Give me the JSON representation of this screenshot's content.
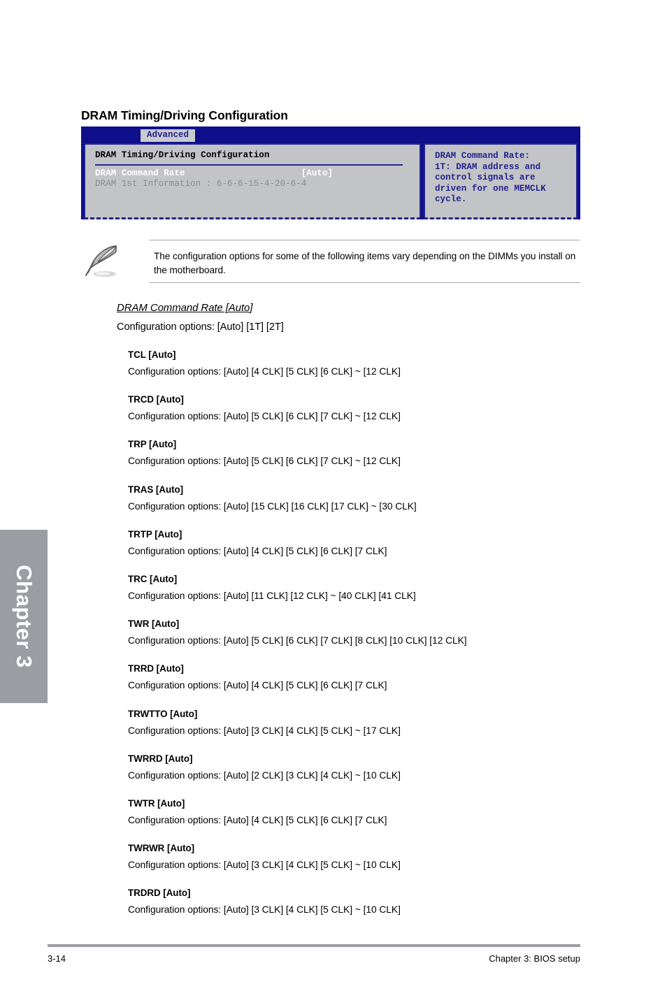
{
  "chapter_tab": {
    "label": "Chapter 3"
  },
  "page_title": "DRAM Timing/Driving Configuration",
  "bios": {
    "tab_label": "Advanced",
    "section_title": "DRAM Timing/Driving Configuration",
    "rows": [
      {
        "label": "DRAM Command Rate",
        "value": "[Auto]"
      },
      {
        "label": "DRAM 1st Information : 6-6-6-15-4-20-6-4",
        "value": ""
      }
    ],
    "row_active_text": "DRAM Command Rate                      [Auto]",
    "row_dim_text": "DRAM 1st Information : 6-6-6-15-4-20-6-4",
    "help_text": "DRAM Command Rate:\n1T: DRAM address and\ncontrol signals are\ndriven for one MEMCLK\ncycle.",
    "colors": {
      "header_blue": "#0f0f8c",
      "panel_gray": "#c3c4c8",
      "border_blue": "#23238c",
      "active_white": "#ffffff",
      "dim_gray": "#8a8b90"
    }
  },
  "note": {
    "icon": "quill-pen-icon",
    "text": "The configuration options for some of the following items vary depending on the DIMMs you install on the motherboard."
  },
  "lead_item": {
    "heading": "DRAM Command Rate [Auto]",
    "options": "Configuration options: [Auto] [1T] [2T]"
  },
  "items": [
    {
      "title": "TCL [Auto]",
      "options": "Configuration options: [Auto] [4 CLK] [5 CLK] [6 CLK] ~ [12 CLK]"
    },
    {
      "title": "TRCD [Auto]",
      "options": "Configuration options: [Auto] [5 CLK] [6 CLK] [7 CLK] ~ [12 CLK]"
    },
    {
      "title": "TRP [Auto]",
      "options": "Configuration options: [Auto] [5 CLK] [6 CLK] [7 CLK] ~ [12 CLK]"
    },
    {
      "title": "TRAS [Auto]",
      "options": "Configuration options: [Auto] [15 CLK] [16 CLK] [17 CLK] ~ [30 CLK]"
    },
    {
      "title": "TRTP [Auto]",
      "options": "Configuration options: [Auto] [4 CLK] [5 CLK] [6 CLK] [7 CLK]"
    },
    {
      "title": "TRC [Auto]",
      "options": "Configuration options: [Auto] [11 CLK] [12 CLK] ~ [40 CLK] [41 CLK]"
    },
    {
      "title": "TWR [Auto]",
      "options": "Configuration options: [Auto] [5 CLK] [6 CLK] [7 CLK] [8 CLK] [10 CLK] [12 CLK]"
    },
    {
      "title": "TRRD [Auto]",
      "options": "Configuration options: [Auto] [4 CLK] [5 CLK] [6 CLK] [7 CLK]"
    },
    {
      "title": "TRWTTO [Auto]",
      "options": "Configuration options: [Auto] [3 CLK] [4 CLK] [5 CLK] ~ [17 CLK]"
    },
    {
      "title": "TWRRD [Auto]",
      "options": "Configuration options: [Auto] [2 CLK] [3 CLK] [4 CLK] ~ [10 CLK]"
    },
    {
      "title": "TWTR [Auto]",
      "options": "Configuration options: [Auto] [4 CLK] [5 CLK] [6 CLK] [7 CLK]"
    },
    {
      "title": "TWRWR [Auto]",
      "options": "Configuration options: [Auto] [3 CLK] [4 CLK] [5 CLK] ~ [10 CLK]"
    },
    {
      "title": "TRDRD [Auto]",
      "options": "Configuration options: [Auto] [3 CLK] [4 CLK] [5 CLK] ~ [10 CLK]"
    }
  ],
  "footer": {
    "page_number": "3-14",
    "chapter_label": "Chapter 3: BIOS setup"
  }
}
